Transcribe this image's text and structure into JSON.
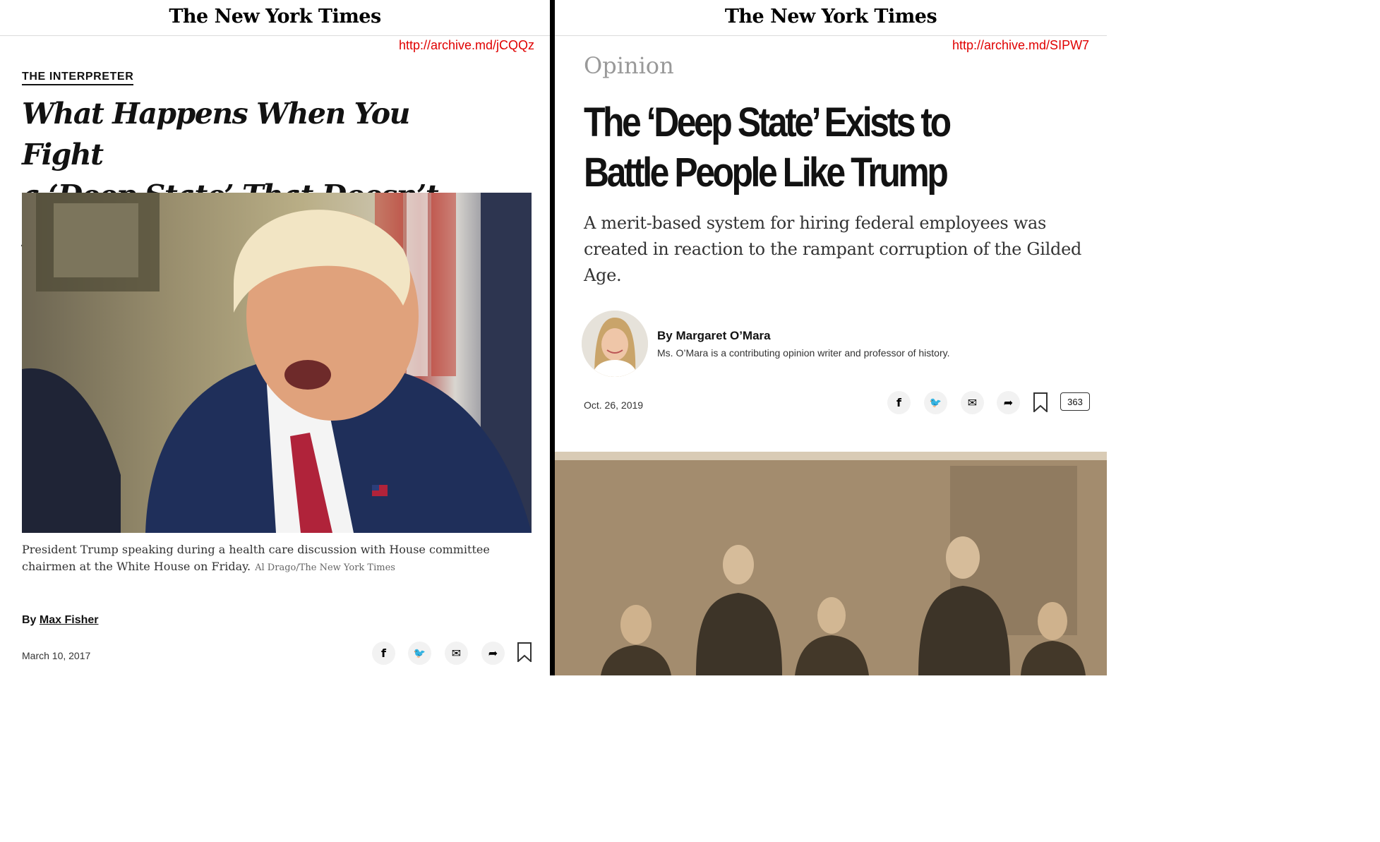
{
  "left": {
    "masthead": "The New York Times",
    "archive_link": "http://archive.md/jCQQz",
    "kicker": "THE INTERPRETER",
    "headline_line1": "What Happens When You Fight",
    "headline_line2": "a ‘Deep State’ That Doesn’t Exist",
    "caption": "President Trump speaking during a health care discussion with House committee chairmen at the White House on Friday.",
    "credit": "Al Drago/The New York Times",
    "byline_prefix": "By",
    "author": "Max Fisher",
    "date": "March 10, 2017",
    "share_icons": [
      "facebook-icon",
      "twitter-icon",
      "email-icon",
      "share-icon",
      "bookmark-icon"
    ],
    "share_glyphs": {
      "facebook": "f",
      "twitter": "🐦",
      "email": "✉",
      "share": "➦"
    }
  },
  "right": {
    "masthead": "The New York Times",
    "archive_link": "http://archive.md/SIPW7",
    "section": "Opinion",
    "headline_line1": "The ‘Deep State’ Exists to",
    "headline_line2": "Battle People Like Trump",
    "summary": "A merit-based system for hiring federal employees was created in reaction to the rampant corruption of the Gilded Age.",
    "byline": "By Margaret O’Mara",
    "bio": "Ms. O’Mara is a contributing opinion writer and professor of history.",
    "date": "Oct. 26, 2019",
    "comment_count": "363",
    "share_icons": [
      "facebook-icon",
      "twitter-icon",
      "email-icon",
      "share-icon",
      "bookmark-icon",
      "comments-icon"
    ],
    "share_glyphs": {
      "facebook": "f",
      "twitter": "🐦",
      "email": "✉",
      "share": "➦"
    }
  }
}
